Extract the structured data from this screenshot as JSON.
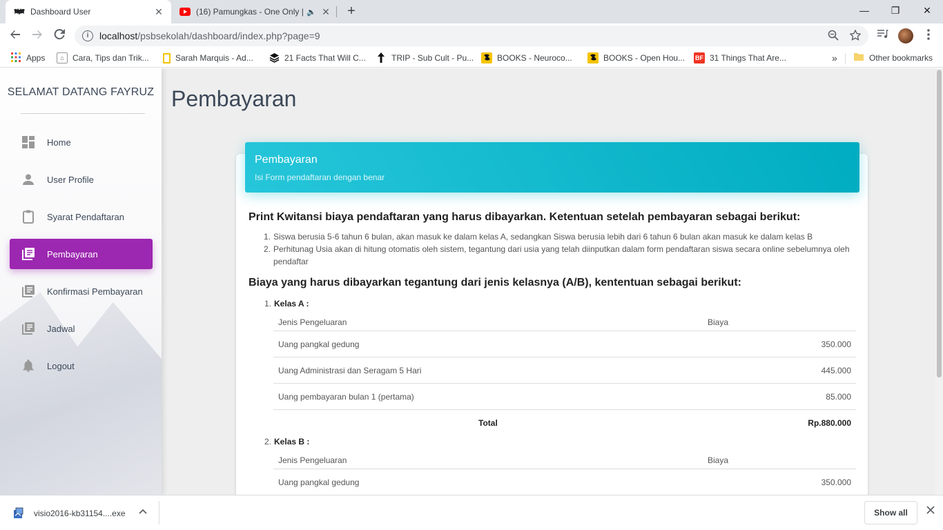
{
  "browser": {
    "tabs": [
      {
        "title": "Dashboard User",
        "icon": "batman-icon",
        "close": "✕"
      },
      {
        "title": "(16) Pamungkas - One Only |",
        "icon": "youtube-icon",
        "audio": "🔈",
        "close": "✕"
      }
    ],
    "new_tab": "+",
    "window_controls": {
      "minimize": "—",
      "maximize": "❐",
      "close": "✕"
    },
    "url_host": "localhost",
    "url_path": "/psbsekolah/dashboard/index.php?page=9",
    "bookmarks": [
      {
        "label": "Apps",
        "icon": "apps-grid-icon"
      },
      {
        "label": "Cara, Tips dan Trik...",
        "icon": "tips-icon"
      },
      {
        "label": "Sarah Marquis - Ad...",
        "icon": "yellow-box-icon"
      },
      {
        "label": "21 Facts That Will C...",
        "icon": "layers-icon"
      },
      {
        "label": "TRIP - Sub Cult - Pu...",
        "icon": "arrow-up-icon"
      },
      {
        "label": "BOOKS - Neuroco...",
        "icon": "bird-icon"
      },
      {
        "label": "BOOKS - Open Hou...",
        "icon": "bird-icon"
      },
      {
        "label": "31 Things That Are...",
        "icon": "bf-icon"
      }
    ],
    "more_bookmarks": "»",
    "other_bookmarks": "Other bookmarks"
  },
  "sidebar": {
    "brand": "SELAMAT DATANG FAYRUZ",
    "items": [
      {
        "label": "Home",
        "icon": "dashboard-icon",
        "active": false
      },
      {
        "label": "User Profile",
        "icon": "person-icon",
        "active": false
      },
      {
        "label": "Syarat Pendaftaran",
        "icon": "clipboard-icon",
        "active": false
      },
      {
        "label": "Pembayaran",
        "icon": "library-books-icon",
        "active": true
      },
      {
        "label": "Konfirmasi Pembayaran",
        "icon": "library-books-icon",
        "active": false
      },
      {
        "label": "Jadwal",
        "icon": "library-books-icon",
        "active": false
      },
      {
        "label": "Logout",
        "icon": "bell-icon",
        "active": false
      }
    ]
  },
  "main": {
    "page_title": "Pembayaran",
    "card": {
      "header_title": "Pembayaran",
      "header_subtitle": "Isi Form pendaftaran dengan benar",
      "heading1": "Print Kwitansi biaya pendaftaran yang harus dibayarkan. Ketentuan setelah pembayaran sebagai berikut:",
      "rules": [
        {
          "num": "1.",
          "text": "Siswa berusia 5-6 tahun 6 bulan, akan masuk ke dalam kelas A, sedangkan Siswa berusia lebih dari 6 tahun 6 bulan akan masuk ke dalam kelas B"
        },
        {
          "num": "2.",
          "text": "Perhitunag Usia akan di hitung otomatis oleh sistem, tegantung dari usia yang telah diinputkan dalam form pendaftaran siswa secara online sebelumnya oleh pendaftar"
        }
      ],
      "heading2": "Biaya yang harus dibayarkan tegantung dari jenis kelasnya (A/B), kententuan sebagai berikut:",
      "classes": [
        {
          "num": "1.",
          "name": "Kelas A :",
          "col1": "Jenis Pengeluaran",
          "col2": "Biaya",
          "rows": [
            {
              "item": "Uang pangkal gedung",
              "cost": "350.000"
            },
            {
              "item": "Uang Administrasi dan Seragam 5 Hari",
              "cost": "445.000"
            },
            {
              "item": "Uang pembayaran bulan 1 (pertama)",
              "cost": "85.000"
            }
          ],
          "total_label": "Total",
          "total_value": "Rp.880.000"
        },
        {
          "num": "2.",
          "name": "Kelas B :",
          "col1": "Jenis Pengeluaran",
          "col2": "Biaya",
          "rows": [
            {
              "item": "Uang pangkal gedung",
              "cost": "350.000"
            }
          ]
        }
      ]
    }
  },
  "downloads": {
    "file": "visio2016-kb31154....exe",
    "show_all": "Show all"
  },
  "colors": {
    "active_nav": "#9c27b0",
    "card_header": "#00bcd4"
  }
}
